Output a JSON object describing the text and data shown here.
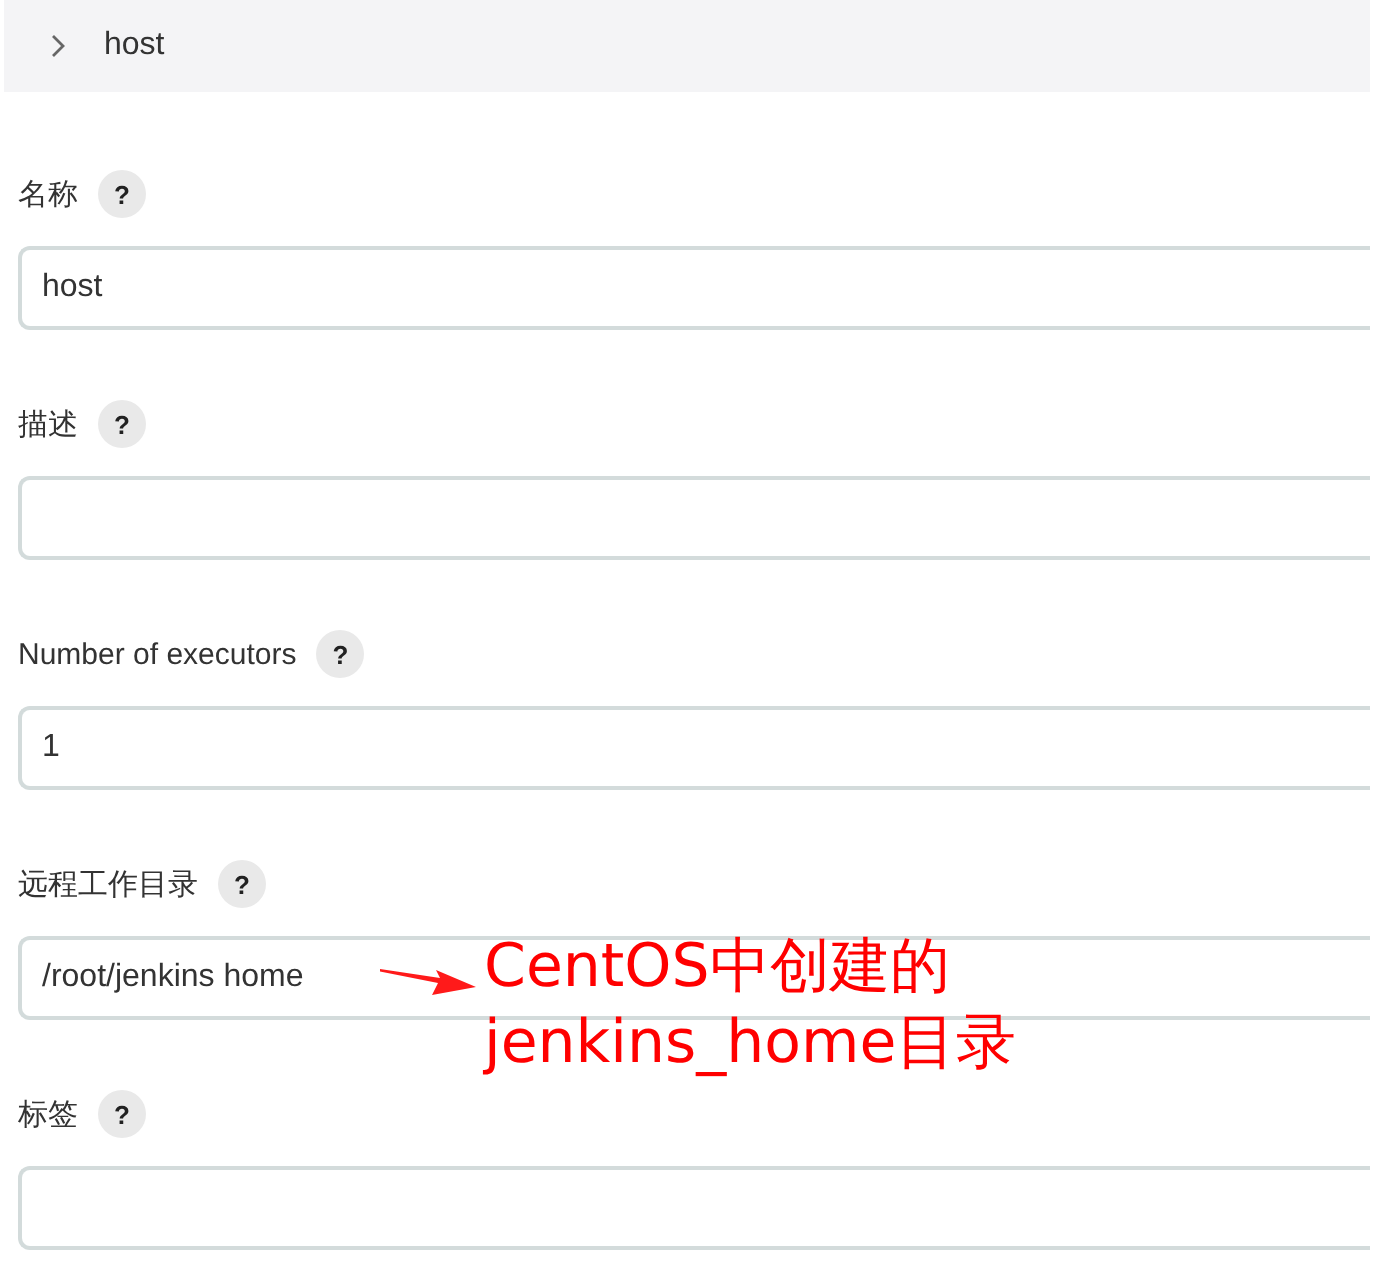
{
  "breadcrumb": {
    "current": "host"
  },
  "fields": [
    {
      "label": "名称",
      "help": "?",
      "value": "host"
    },
    {
      "label": "描述",
      "help": "?"
    },
    {
      "label": "Number of executors",
      "help": "?",
      "value": "1"
    },
    {
      "label": "远程工作目录",
      "help": "?",
      "value": "/root/jenkins home",
      "annotation": {
        "lines": [
          "CentOS中创建的",
          "jenkins_home目录"
        ]
      }
    },
    {
      "label": "标签",
      "help": "?"
    }
  ]
}
